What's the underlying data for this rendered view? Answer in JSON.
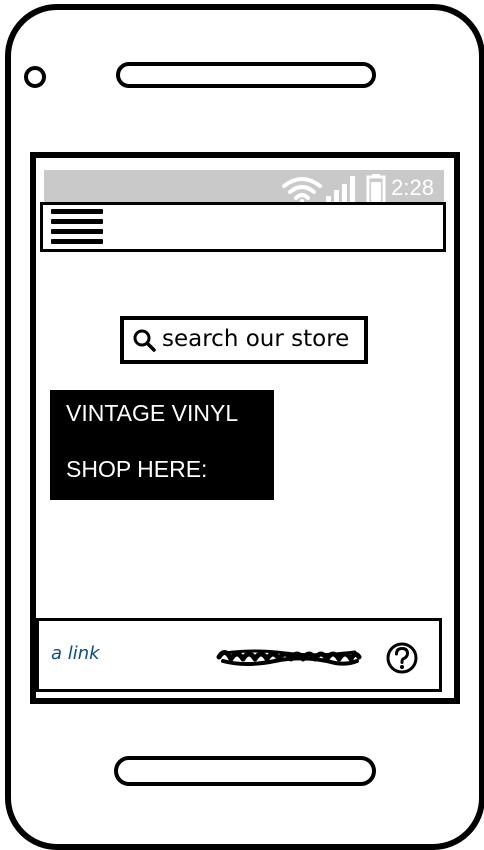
{
  "status_bar": {
    "time": "2:28",
    "icons": [
      "wifi-icon",
      "signal-icon",
      "battery-icon"
    ],
    "background": "#c9c9c9"
  },
  "app_bar": {
    "menu_icon": "hamburger-menu-icon"
  },
  "search": {
    "placeholder": "search our store",
    "icon": "search-icon"
  },
  "promo": {
    "line1": "VINTAGE VINYL",
    "line2": "SHOP HERE:",
    "background": "#000000",
    "text_color": "#ffffff"
  },
  "bottom_bar": {
    "link_text": "a link",
    "link_color": "#0b4d86",
    "help_icon": "question-mark-icon"
  }
}
